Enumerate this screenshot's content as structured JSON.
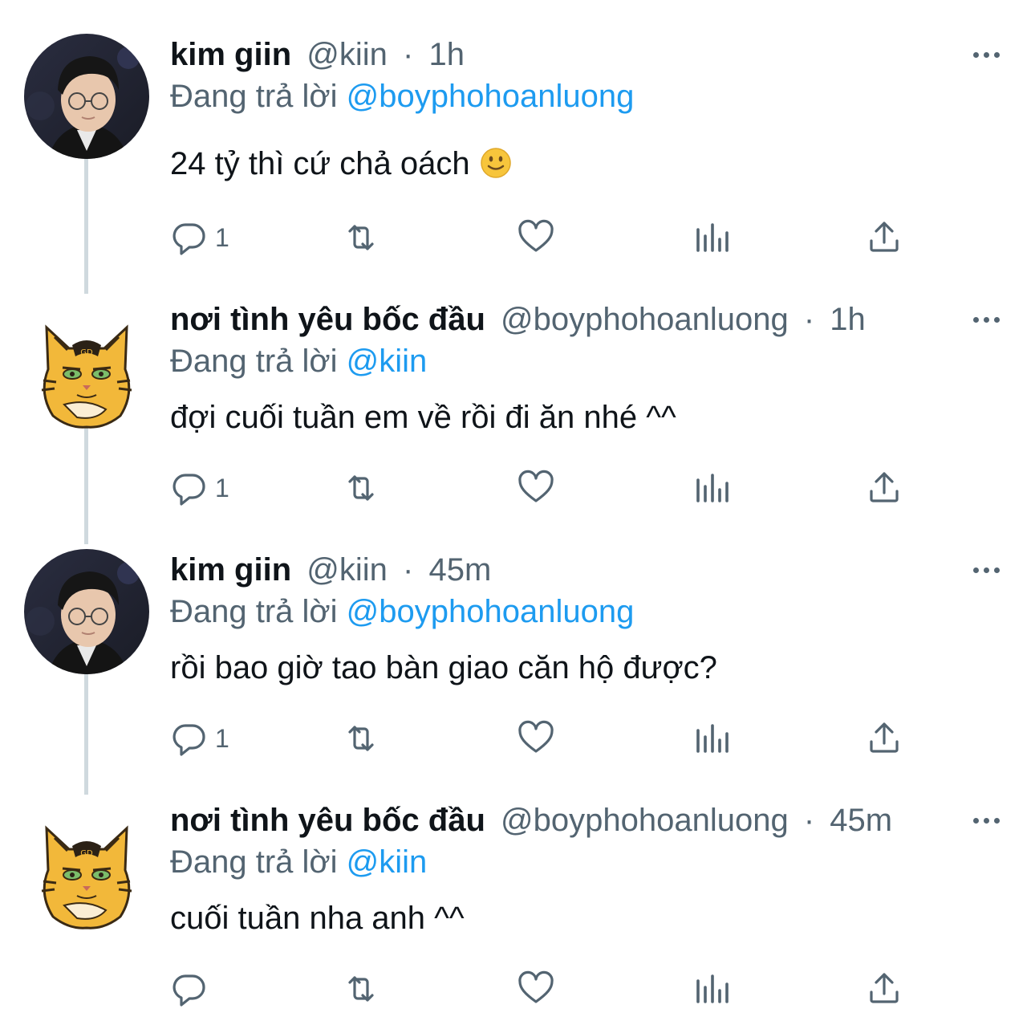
{
  "tweets": [
    {
      "name": "kim giin",
      "handle": "@kiin",
      "separator": "·",
      "time": "1h",
      "replying_prefix": "Đang trả lời",
      "replying_to": "@boyphohoanluong",
      "text": "24 tỷ thì cứ chả oách",
      "emoji": "slightly-smiling-face",
      "reply_count": "1",
      "avatar": "person-photo"
    },
    {
      "name": "nơi tình yêu bốc đầu",
      "handle": "@boyphohoanluong",
      "separator": "·",
      "time": "1h",
      "replying_prefix": "Đang trả lời",
      "replying_to": "@kiin",
      "text": "đợi cuối tuần em về rồi đi ăn nhé ^^",
      "reply_count": "1",
      "avatar": "tiger-cat-illustration"
    },
    {
      "name": "kim giin",
      "handle": "@kiin",
      "separator": "·",
      "time": "45m",
      "replying_prefix": "Đang trả lời",
      "replying_to": "@boyphohoanluong",
      "text": "rồi bao giờ tao bàn giao căn hộ được?",
      "reply_count": "1",
      "avatar": "person-photo"
    },
    {
      "name": "nơi tình yêu bốc đầu",
      "handle": "@boyphohoanluong",
      "separator": "·",
      "time": "45m",
      "replying_prefix": "Đang trả lời",
      "replying_to": "@kiin",
      "text": "cuối tuần nha anh ^^",
      "reply_count": "",
      "avatar": "tiger-cat-illustration"
    }
  ],
  "icons": {
    "reply": "reply-icon",
    "retweet": "retweet-icon",
    "like": "heart-icon",
    "views": "analytics-icon",
    "share": "share-icon",
    "more": "more-icon"
  },
  "colors": {
    "text": "#0f1419",
    "secondary": "#536471",
    "mention": "#1d9bf0",
    "thread_line": "#cfd9de",
    "icon": "#536471"
  }
}
